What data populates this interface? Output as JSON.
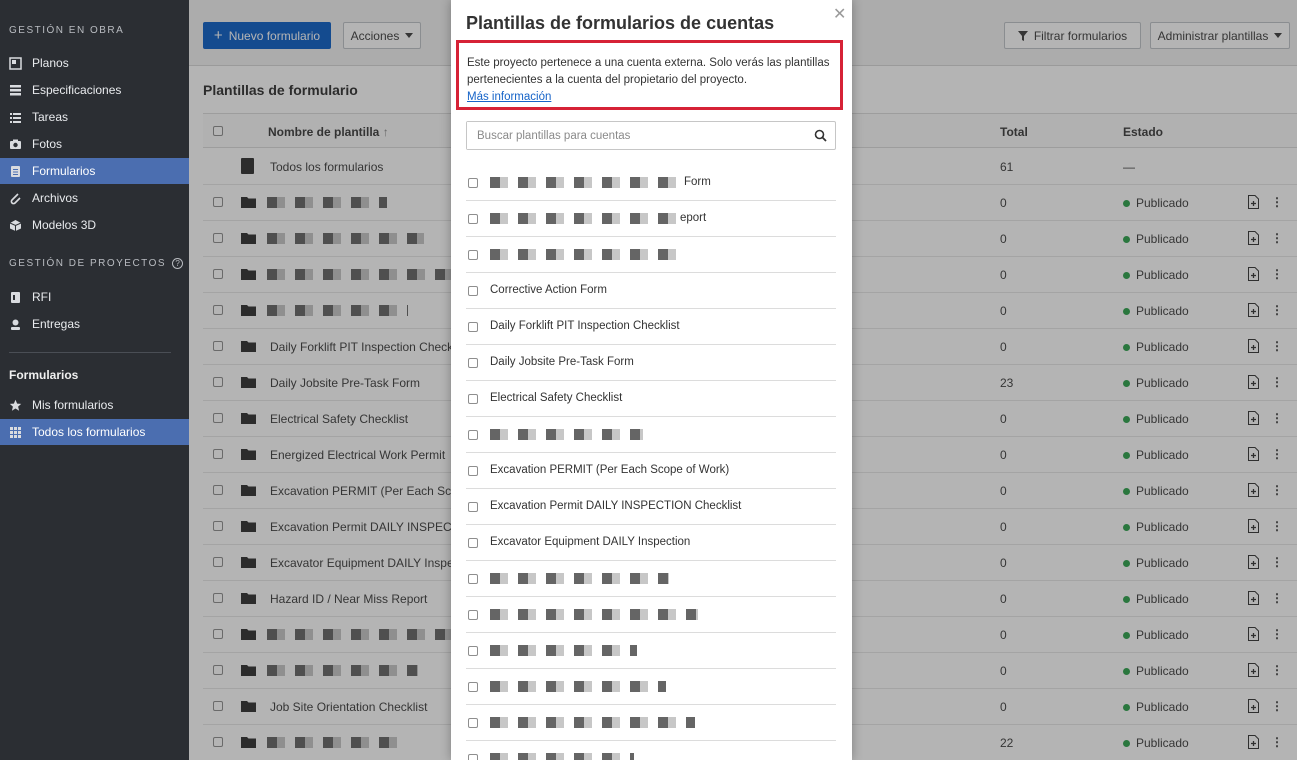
{
  "sidebar": {
    "section1": "GESTIÓN EN OBRA",
    "items1": [
      {
        "label": "Planos",
        "icon": "plans-icon"
      },
      {
        "label": "Especificaciones",
        "icon": "specs-icon"
      },
      {
        "label": "Tareas",
        "icon": "tasks-icon"
      },
      {
        "label": "Fotos",
        "icon": "camera-icon"
      },
      {
        "label": "Formularios",
        "icon": "forms-icon"
      },
      {
        "label": "Archivos",
        "icon": "paperclip-icon"
      },
      {
        "label": "Modelos 3D",
        "icon": "cube-icon"
      }
    ],
    "section2": "GESTIÓN DE PROYECTOS",
    "items2": [
      {
        "label": "RFI",
        "icon": "rfi-icon"
      },
      {
        "label": "Entregas",
        "icon": "submittal-icon"
      }
    ],
    "heading": "Formularios",
    "items3": [
      {
        "label": "Mis formularios",
        "icon": "star-icon"
      },
      {
        "label": "Todos los formularios",
        "icon": "grid-icon"
      }
    ]
  },
  "toolbar": {
    "new_form": "Nuevo formulario",
    "actions": "Acciones",
    "filter": "Filtrar formularios",
    "manage": "Administrar plantillas"
  },
  "main": {
    "section_title": "Plantillas de formulario",
    "columns": {
      "name": "Nombre de plantilla",
      "total": "Total",
      "status": "Estado"
    },
    "all_forms_row": {
      "name": "Todos los formularios",
      "total": "61",
      "status": "—"
    },
    "rows": [
      {
        "name": "",
        "total": "0",
        "status": "Publicado"
      },
      {
        "name": "",
        "total": "0",
        "status": "Publicado"
      },
      {
        "name": "",
        "total": "0",
        "status": "Publicado"
      },
      {
        "name": "",
        "total": "0",
        "status": "Publicado"
      },
      {
        "name": "Daily Forklift PIT Inspection Checkl",
        "total": "0",
        "status": "Publicado"
      },
      {
        "name": "Daily Jobsite Pre-Task Form",
        "total": "23",
        "status": "Publicado"
      },
      {
        "name": "Electrical Safety Checklist",
        "total": "0",
        "status": "Publicado"
      },
      {
        "name": "Energized Electrical Work Permit",
        "total": "0",
        "status": "Publicado"
      },
      {
        "name": "Excavation PERMIT (Per Each Scope",
        "total": "0",
        "status": "Publicado"
      },
      {
        "name": "Excavation Permit DAILY INSPECTI",
        "total": "0",
        "status": "Publicado"
      },
      {
        "name": "Excavator Equipment DAILY Inspec",
        "total": "0",
        "status": "Publicado"
      },
      {
        "name": "Hazard ID / Near Miss Report",
        "total": "0",
        "status": "Publicado"
      },
      {
        "name": "",
        "total": "0",
        "status": "Publicado"
      },
      {
        "name": "",
        "total": "0",
        "status": "Publicado"
      },
      {
        "name": "Job Site Orientation Checklist",
        "total": "0",
        "status": "Publicado"
      },
      {
        "name": "",
        "total": "22",
        "status": "Publicado"
      }
    ]
  },
  "modal": {
    "title": "Plantillas de formularios de cuentas",
    "notice": "Este proyecto pertenece a una cuenta externa. Solo verás las plantillas pertenecientes a la cuenta del propietario del proyecto.",
    "notice_link": "Más información",
    "search_placeholder": "Buscar plantillas para cuentas",
    "items": [
      "Form",
      "eport",
      "",
      "Corrective Action Form",
      "Daily Forklift PIT Inspection Checklist",
      "Daily Jobsite Pre-Task Form",
      "Electrical Safety Checklist",
      "",
      "Excavation PERMIT (Per Each Scope of Work)",
      "Excavation Permit DAILY INSPECTION Checklist",
      "Excavator Equipment DAILY Inspection",
      "",
      "",
      "",
      "",
      "",
      ""
    ]
  }
}
